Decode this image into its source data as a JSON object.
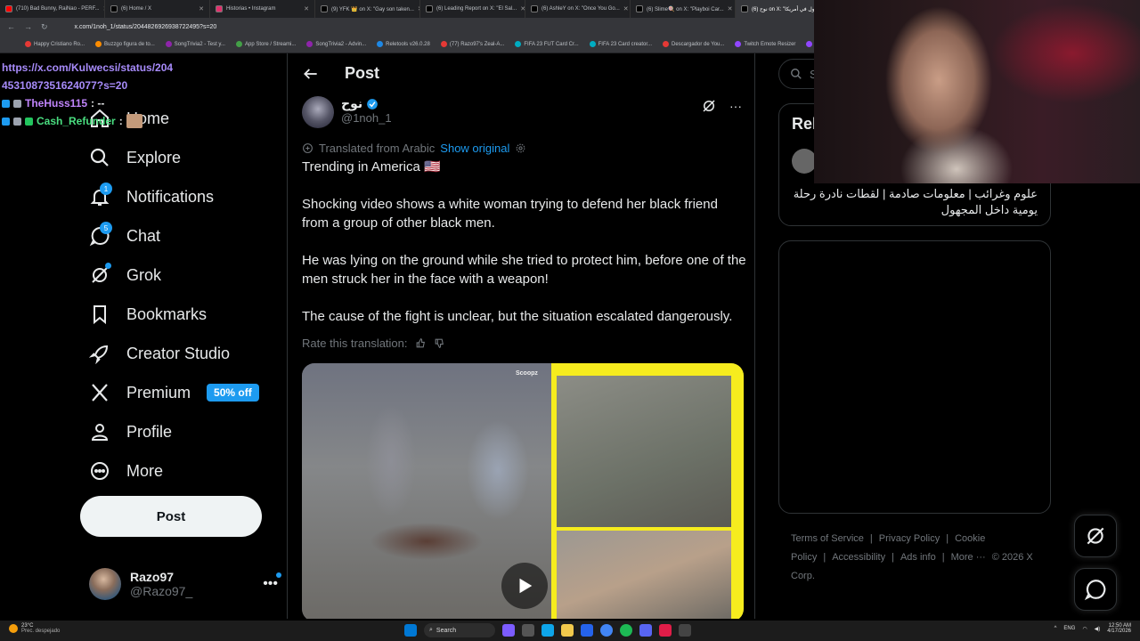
{
  "browser": {
    "tabs": [
      {
        "title": "(710) Bad Bunny, RaiNao - PERF...",
        "color": "#ff0000"
      },
      {
        "title": "(6) Home / X",
        "color": "#000000"
      },
      {
        "title": "Historias • Instagram",
        "color": "#e1306c"
      },
      {
        "title": "(9) YFK 👑 on X: \"Gay son taken...",
        "color": "#000000"
      },
      {
        "title": "(6) Leading Report on X: \"El Sal...",
        "color": "#000000"
      },
      {
        "title": "(6) AshleY on X: \"Once You Go...",
        "color": "#000000"
      },
      {
        "title": "(6) Slime🍭 on X: \"Playboi Car...",
        "color": "#000000"
      },
      {
        "title": "(6) نوح on X: \"نداول في أمريكا...",
        "color": "#000000"
      }
    ],
    "url": "x.com/1noh_1/status/2044826926938722495?s=20",
    "bookmarks": [
      {
        "label": "Happy Cristiano Ro...",
        "color": "#e53935"
      },
      {
        "label": "Buzzgo figura de to...",
        "color": "#fb8c00"
      },
      {
        "label": "SongTrivia2 - Test y...",
        "color": "#8e24aa"
      },
      {
        "label": "App Store / Streami...",
        "color": "#43a047"
      },
      {
        "label": "SongTrivia2 - Advin...",
        "color": "#8e24aa"
      },
      {
        "label": "Reletools v26.0.28",
        "color": "#1e88e5"
      },
      {
        "label": "(77) Razo97's Zeal-A...",
        "color": "#e53935"
      },
      {
        "label": "FIFA 23 FUT Card Cr...",
        "color": "#00acc1"
      },
      {
        "label": "FIFA 23 Card creator...",
        "color": "#00acc1"
      },
      {
        "label": "Descargador de You...",
        "color": "#e53935"
      },
      {
        "label": "Twitch Emote Resizer",
        "color": "#9146ff"
      },
      {
        "label": "twitch emote re...",
        "color": "#9146ff"
      }
    ]
  },
  "overlay": {
    "url_line1": "https://x.com/Kulwecsi/status/204",
    "url_line2": "4531087351624077?s=20",
    "chat": [
      {
        "user": "TheHuss115",
        "msg": ": --",
        "color": "#c084fc"
      },
      {
        "user": "Cash_Refunder",
        "msg": ":",
        "color": "#4ade80"
      }
    ]
  },
  "sidebar": {
    "items": [
      {
        "label": "Home",
        "icon": "home-icon"
      },
      {
        "label": "Explore",
        "icon": "search-icon"
      },
      {
        "label": "Notifications",
        "icon": "bell-icon",
        "badge": "1"
      },
      {
        "label": "Chat",
        "icon": "chat-icon",
        "badge": "5"
      },
      {
        "label": "Grok",
        "icon": "grok-icon"
      },
      {
        "label": "Bookmarks",
        "icon": "bookmark-icon"
      },
      {
        "label": "Creator Studio",
        "icon": "rocket-icon"
      },
      {
        "label": "Premium",
        "icon": "x-logo-icon",
        "promo": "50% off"
      },
      {
        "label": "Profile",
        "icon": "person-icon"
      },
      {
        "label": "More",
        "icon": "more-circle-icon"
      }
    ],
    "post_button": "Post",
    "account": {
      "name": "Razo97",
      "handle": "@Razo97_"
    }
  },
  "post": {
    "header_title": "Post",
    "author_name": "نوح",
    "author_handle": "@1noh_1",
    "translated_from": "Translated from Arabic",
    "show_original": "Show original",
    "paragraphs": [
      "Trending in America 🇺🇸",
      "Shocking video shows a white woman trying to defend her black friend from a group of other black men.",
      "He was lying on the ground while she tried to protect him, before one of the men struck her in the face with a weapon!",
      "The cause of the fight is unclear, but the situation escalated dangerously."
    ],
    "rate_translation": "Rate this translation:",
    "media_watermark": "Scoopz"
  },
  "right": {
    "search_placeholder": "Se",
    "relevant_title": "Rel",
    "relevant_bio": "علوم وغرائب | معلومات صادمة | لقطات نادرة رحلة يومية داخل المجهول",
    "footer": [
      "Terms of Service",
      "|",
      "Privacy Policy",
      "|",
      "Cookie Policy",
      "|",
      "Accessibility",
      "|",
      "Ads info",
      "|",
      "More ···",
      "© 2026 X Corp."
    ]
  },
  "taskbar": {
    "weather_temp": "23°C",
    "weather_desc": "Prec. despejado",
    "search_label": "Search",
    "lang": "ENG",
    "time": "12:50 AM",
    "date": "4/17/2026"
  },
  "colors": {
    "accent": "#1d9bf0",
    "bg": "#000000",
    "border": "#2f3336",
    "muted": "#71767b"
  }
}
